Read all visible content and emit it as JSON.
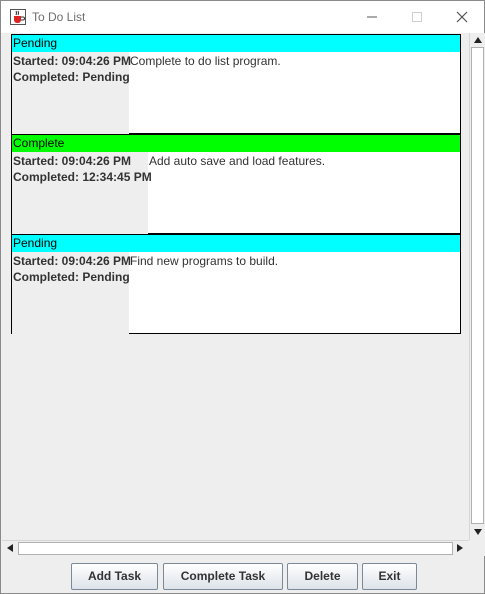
{
  "window": {
    "title": "To Do List"
  },
  "colors": {
    "pending": "#00ffff",
    "complete": "#00ff00"
  },
  "tasks": [
    {
      "status": "Pending",
      "started": "Started: 09:04:26 PM",
      "completed": "Completed: Pending",
      "description": "Complete to do list program."
    },
    {
      "status": "Complete",
      "started": "Started: 09:04:26 PM",
      "completed": "Completed: 12:34:45 PM",
      "description": "Add auto save and load features."
    },
    {
      "status": "Pending",
      "started": "Started: 09:04:26 PM",
      "completed": "Completed: Pending",
      "description": "Find new programs to build."
    }
  ],
  "buttons": {
    "add": "Add Task",
    "complete": "Complete Task",
    "delete": "Delete",
    "exit": "Exit"
  },
  "icons": {
    "app": "java-cup-icon",
    "minimize": "minimize-icon",
    "maximize": "maximize-icon",
    "close": "close-icon"
  }
}
